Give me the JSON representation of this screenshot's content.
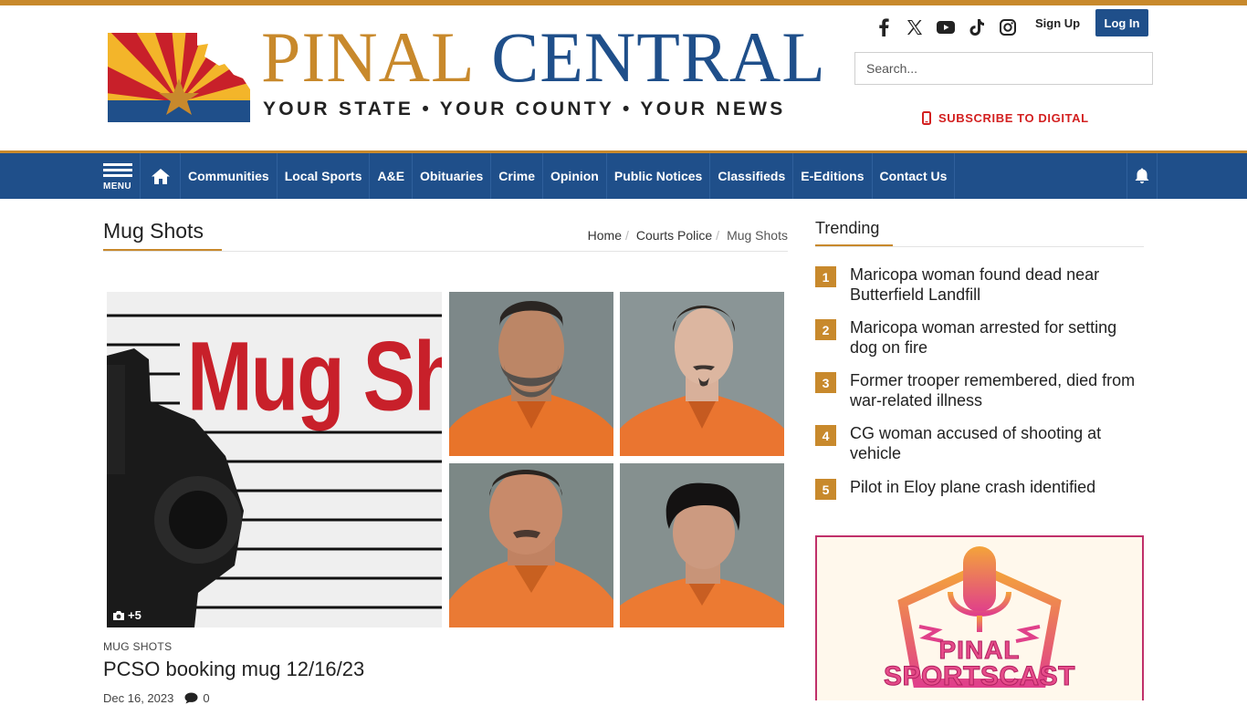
{
  "brand": {
    "name_part1": "PINAL",
    "name_part2": "CENTRAL",
    "tagline": "YOUR STATE • YOUR COUNTY • YOUR NEWS",
    "colors": {
      "gold": "#c8892c",
      "blue": "#1f4f8a",
      "red": "#d32020"
    }
  },
  "header": {
    "social_icons": [
      "facebook-icon",
      "x-icon",
      "youtube-icon",
      "tiktok-icon",
      "instagram-icon"
    ],
    "signup_label": "Sign Up",
    "login_label": "Log In",
    "search_placeholder": "Search...",
    "subscribe_label": "SUBSCRIBE TO DIGITAL"
  },
  "nav": {
    "menu_label": "MENU",
    "items": [
      "Communities",
      "Local Sports",
      "A&E",
      "Obituaries",
      "Crime",
      "Opinion",
      "Public Notices",
      "Classifieds",
      "E-Editions",
      "Contact Us"
    ]
  },
  "page": {
    "title": "Mug Shots",
    "breadcrumb": [
      "Home",
      "Courts Police",
      "Mug Shots"
    ]
  },
  "article": {
    "main_image_text": "Mug Sho",
    "photo_count": "+5",
    "kicker": "MUG SHOTS",
    "headline": "PCSO booking mug 12/16/23",
    "date": "Dec 16, 2023",
    "comments": "0"
  },
  "trending": {
    "title": "Trending",
    "items": [
      {
        "num": "1",
        "text": "Maricopa woman found dead near Butterfield Landfill"
      },
      {
        "num": "2",
        "text": "Maricopa woman arrested for setting dog on fire"
      },
      {
        "num": "3",
        "text": "Former trooper remembered, died from war-related illness"
      },
      {
        "num": "4",
        "text": "CG woman accused of shooting at vehicle"
      },
      {
        "num": "5",
        "text": "Pilot in Eloy plane crash identified"
      }
    ]
  },
  "ad": {
    "line1": "PINAL",
    "line2": "SPORTSCAST"
  }
}
